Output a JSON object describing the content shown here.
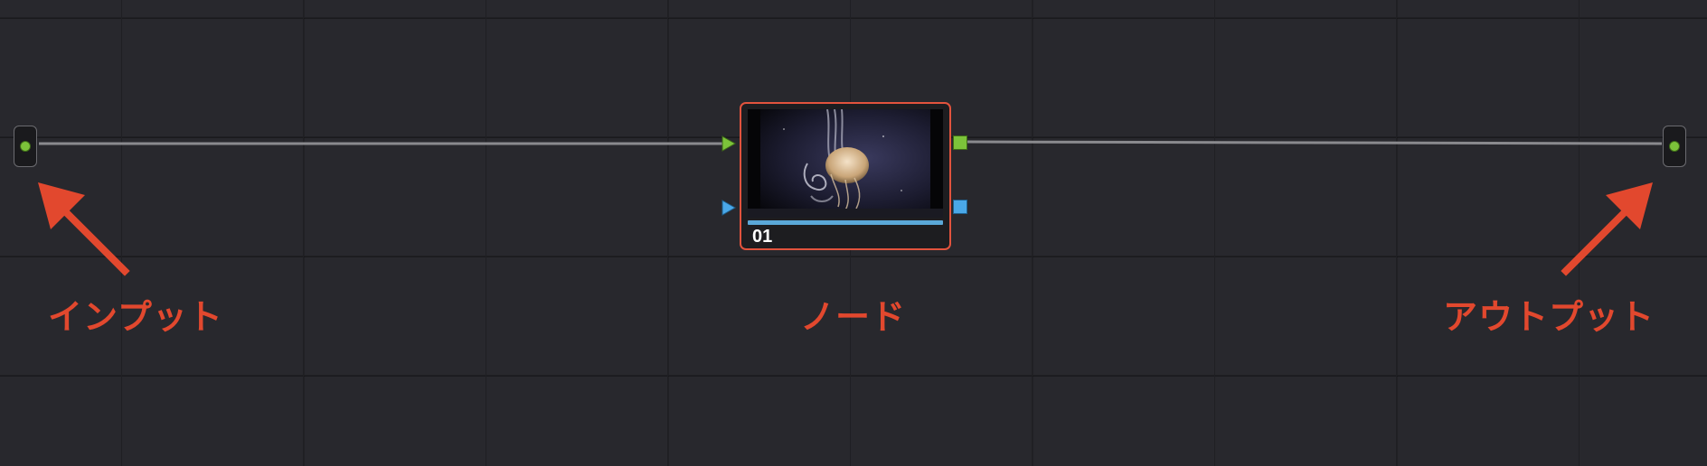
{
  "node": {
    "label": "01",
    "thumbnail": "jellyfish-thumbnail"
  },
  "annotations": {
    "input": "インプット",
    "node": "ノード",
    "output": "アウトプット"
  },
  "colors": {
    "background": "#28282d",
    "gridline": "#1f1f23",
    "wire": "#8a8a8e",
    "node_border": "#e2533d",
    "annotation": "#e2482e",
    "rgb_port": "#7cc33a",
    "alpha_port": "#4aa8e8",
    "progress": "#5aa8d8"
  },
  "icons": {
    "input_endpoint": "green-dot-icon",
    "output_endpoint": "green-dot-icon",
    "rgb_input_port": "green-triangle-icon",
    "alpha_input_port": "blue-triangle-icon",
    "rgb_output_port": "green-square-icon",
    "alpha_output_port": "blue-square-icon"
  }
}
